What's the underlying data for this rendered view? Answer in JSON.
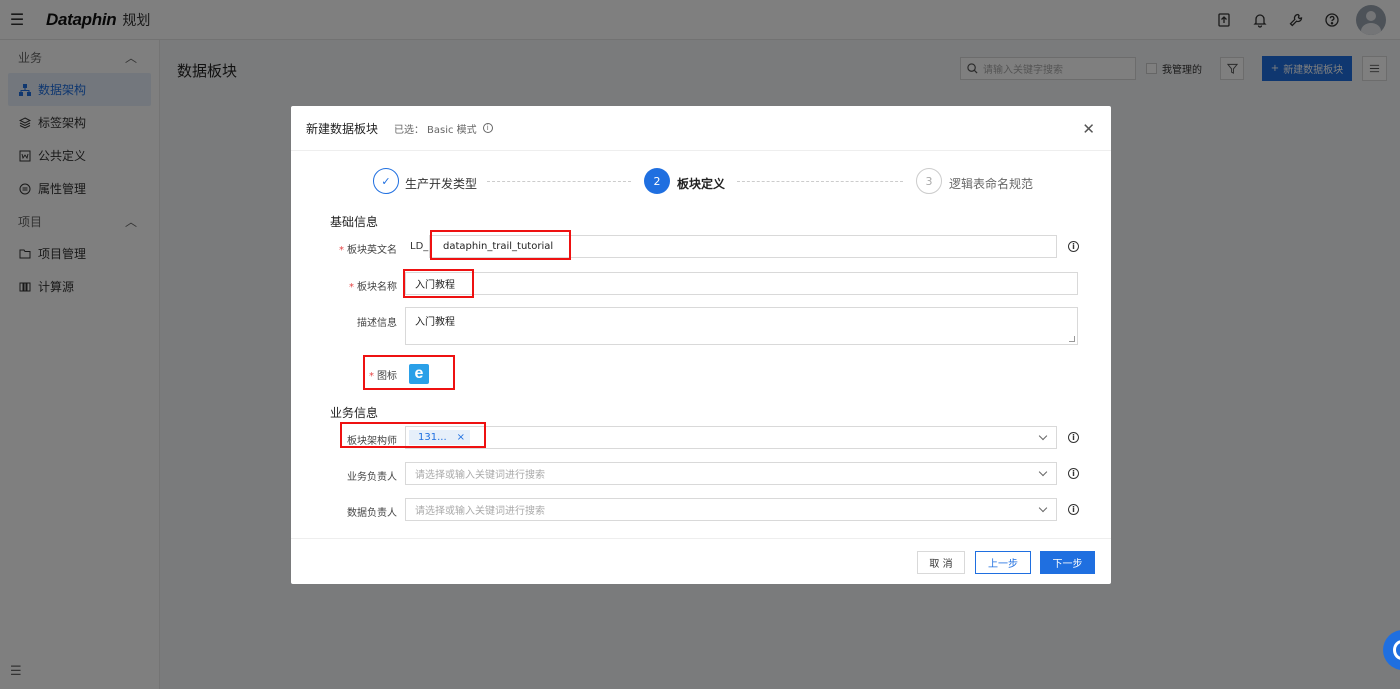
{
  "app": {
    "logo": "Dataphin",
    "module": "规划"
  },
  "sidebar": {
    "groups": [
      {
        "label": "业务",
        "items": [
          {
            "label": "数据架构",
            "icon": "tree-icon",
            "active": true
          },
          {
            "label": "标签架构",
            "icon": "layers-icon"
          },
          {
            "label": "公共定义",
            "icon": "word-icon"
          },
          {
            "label": "属性管理",
            "icon": "attribute-icon"
          }
        ]
      },
      {
        "label": "项目",
        "items": [
          {
            "label": "项目管理",
            "icon": "folder-icon"
          },
          {
            "label": "计算源",
            "icon": "compute-icon"
          }
        ]
      }
    ]
  },
  "page": {
    "title": "数据板块",
    "search_placeholder": "请输入关键字搜索",
    "managed_label": "我管理的",
    "new_button": "新建数据板块"
  },
  "modal": {
    "title": "新建数据板块",
    "selected_label": "已选：",
    "selected_value": "Basic 模式",
    "steps": [
      {
        "number": "1",
        "label": "生产开发类型",
        "status": "done"
      },
      {
        "number": "2",
        "label": "板块定义",
        "status": "active"
      },
      {
        "number": "3",
        "label": "逻辑表命名规范",
        "status": "pending"
      }
    ],
    "basic_section": "基础信息",
    "fields": {
      "english_name": {
        "label": "板块英文名",
        "prefix": "LD_",
        "value": "dataphin_trail_tutorial",
        "required": true
      },
      "name": {
        "label": "板块名称",
        "value": "入门教程",
        "required": true
      },
      "description": {
        "label": "描述信息",
        "value": "入门教程"
      },
      "icon": {
        "label": "图标",
        "glyph": "e",
        "required": true
      }
    },
    "business_section": "业务信息",
    "business_fields": {
      "architect": {
        "label": "板块架构师",
        "tag": "131...",
        "tag_close": "×"
      },
      "business_owner": {
        "label": "业务负责人",
        "placeholder": "请选择或输入关键词进行搜索"
      },
      "data_owner": {
        "label": "数据负责人",
        "placeholder": "请选择或输入关键词进行搜索"
      }
    },
    "footer": {
      "cancel": "取 消",
      "prev": "上一步",
      "next": "下一步"
    }
  },
  "colors": {
    "primary": "#1f6fe0",
    "highlight": "#ee1111",
    "required": "#e54545"
  }
}
